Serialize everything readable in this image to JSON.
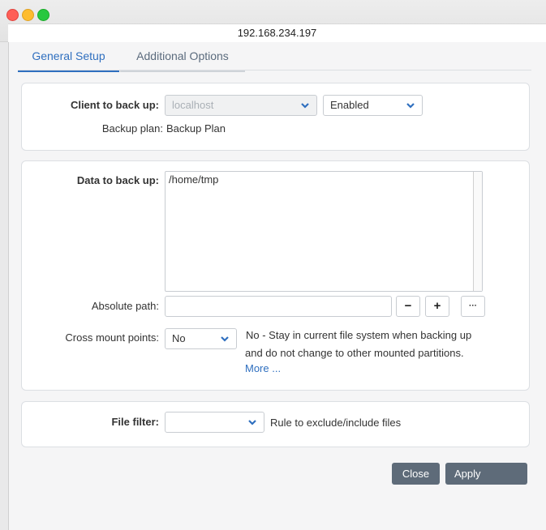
{
  "window": {
    "address": "192.168.234.197"
  },
  "tabs": [
    {
      "label": "General Setup",
      "active": true
    },
    {
      "label": "Additional Options",
      "active": false
    }
  ],
  "client": {
    "label": "Client to back up:",
    "host_value": "localhost",
    "state_value": "Enabled",
    "plan_label": "Backup plan:",
    "plan_value": "Backup Plan"
  },
  "data": {
    "label": "Data to back up:",
    "paths_text": "/home/tmp",
    "absolute_path_label": "Absolute path:",
    "absolute_path_value": "",
    "remove_label": "−",
    "add_label": "+",
    "browse_label": "···",
    "cross_mount_label": "Cross mount points:",
    "cross_mount_value": "No",
    "cross_mount_desc_line1": "No - Stay in current file system when backing up",
    "cross_mount_desc_line2": "and do not change to other mounted partitions.",
    "more_link": "More ..."
  },
  "filter": {
    "label": "File filter:",
    "value": "",
    "desc": "Rule to exclude/include files"
  },
  "actions": {
    "close_label": "Close",
    "apply_label": "Apply"
  },
  "colors": {
    "accent": "#2f6fbf",
    "button_bg": "#5e6b79"
  }
}
